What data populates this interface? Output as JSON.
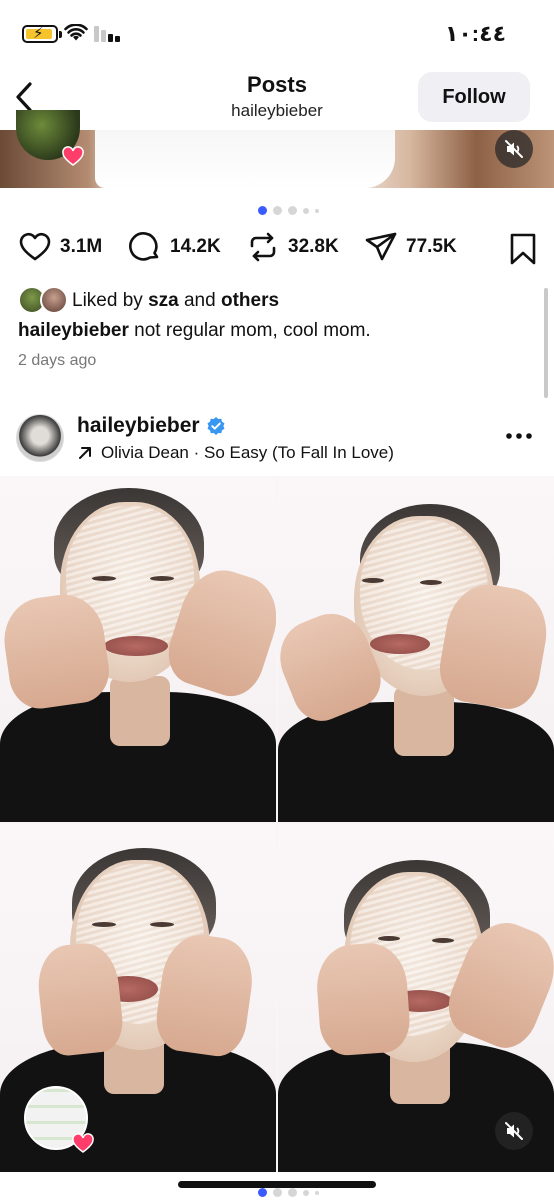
{
  "status_bar": {
    "time": "١٠:٤٤",
    "battery_icon": "battery-charging-icon",
    "wifi_icon": "wifi-icon",
    "signal_icon": "cellular-signal-icon"
  },
  "header": {
    "title": "Posts",
    "subtitle": "haileybieber",
    "follow_label": "Follow",
    "back_icon": "chevron-left-icon"
  },
  "top_post": {
    "pagination": {
      "total": 5,
      "active": 1
    },
    "actions": {
      "likes": "3.1M",
      "comments": "14.2K",
      "reposts": "32.8K",
      "shares": "77.5K"
    },
    "liked_by": {
      "prefix": "Liked by",
      "user": "sza",
      "connector": "and",
      "others": "others"
    },
    "caption": {
      "username": "haileybieber",
      "text": "not regular mom, cool mom."
    },
    "date": "2 days ago"
  },
  "second_post": {
    "username": "haileybieber",
    "verified": true,
    "music": "Olivia Dean · So Easy (To Fall In Love)",
    "more_icon": "more-horizontal-icon",
    "pagination": {
      "total": 5,
      "active": 1
    }
  },
  "colors": {
    "accent": "#3b5bff",
    "verified": "#3897f0",
    "heart_badge": "#ff3d6b",
    "follow_bg": "#efeff4"
  }
}
